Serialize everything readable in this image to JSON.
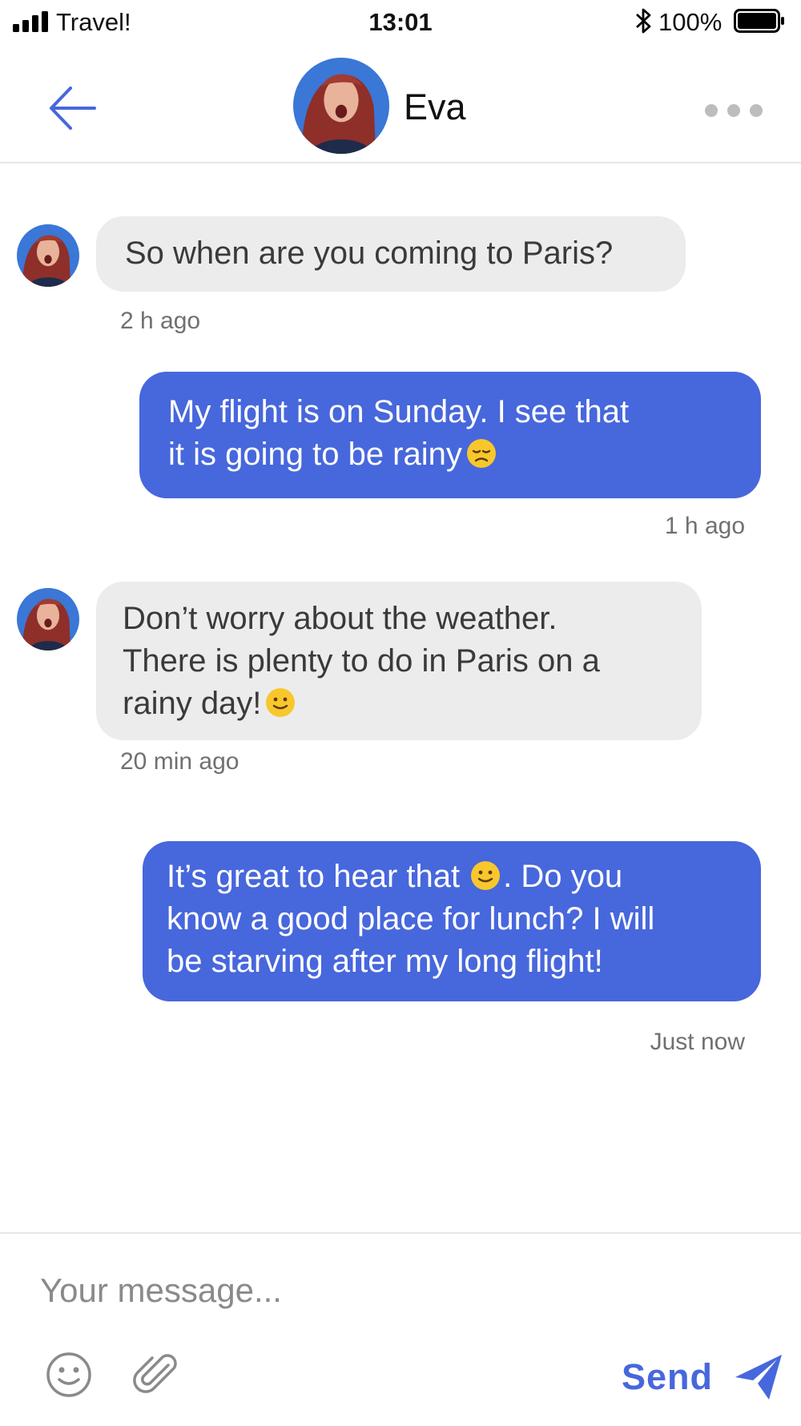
{
  "status_bar": {
    "carrier": "Travel!",
    "time": "13:01",
    "battery": "100%"
  },
  "header": {
    "contact_name": "Eva"
  },
  "messages": [
    {
      "direction": "incoming",
      "text": "So when are you coming to Paris?",
      "time": "2 h ago"
    },
    {
      "direction": "outgoing",
      "line1": "My flight is on Sunday. I see that",
      "line2": "it is going to be rainy",
      "emoji": "disappointed-face",
      "time": "1 h ago"
    },
    {
      "direction": "incoming",
      "line1": "Don’t worry about the weather.",
      "line2": "There is plenty to do in Paris on a",
      "line3": "rainy day!",
      "emoji": "slightly-smiling-face",
      "time": "20 min ago"
    },
    {
      "direction": "outgoing",
      "line1a": "It’s great to hear that",
      "line1b": ". Do you",
      "line2": "know a good place for lunch? I will",
      "line3": "be starving after my long flight!",
      "emoji": "slightly-smiling-face",
      "time": "Just now"
    }
  ],
  "composer": {
    "placeholder": "Your message...",
    "send_label": "Send"
  },
  "colors": {
    "accent": "#4767dc",
    "incoming_bubble": "#ececec",
    "divider": "#e6e6e6",
    "muted_text": "#707070"
  },
  "icons": [
    "signal-icon",
    "bluetooth-icon",
    "battery-icon",
    "back-arrow-icon",
    "more-options-icon",
    "emoji-icon",
    "paperclip-icon",
    "send-icon"
  ]
}
